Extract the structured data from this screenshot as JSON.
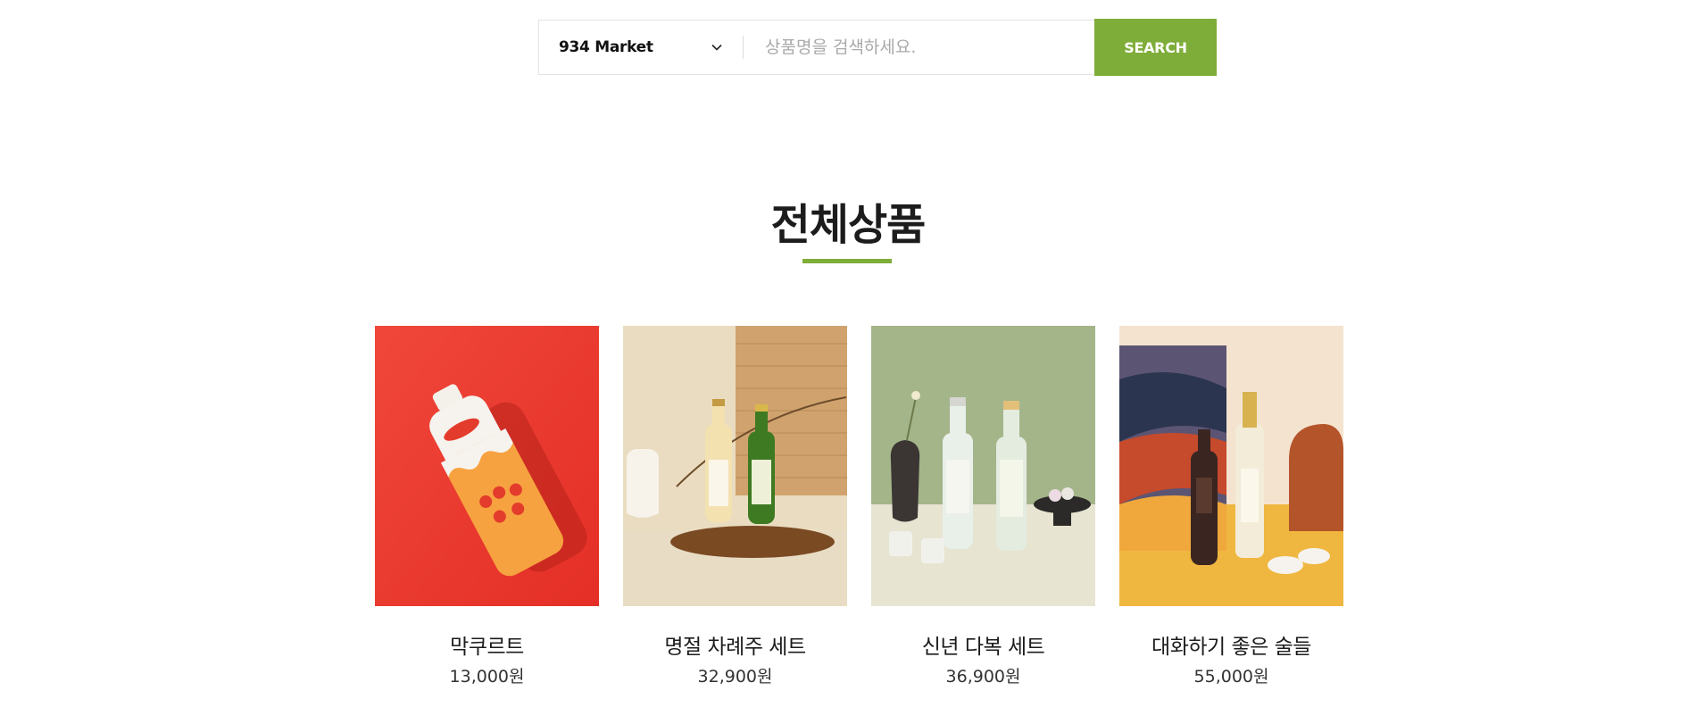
{
  "search": {
    "category_selected": "934 Market",
    "placeholder": "상품명을 검색하세요.",
    "button_label": "SEARCH"
  },
  "section": {
    "title": "전체상품"
  },
  "products": [
    {
      "name": "막쿠르트",
      "price": "13,000원"
    },
    {
      "name": "명절 차례주 세트",
      "price": "32,900원"
    },
    {
      "name": "신년 다복 세트",
      "price": "36,900원"
    },
    {
      "name": "대화하기 좋은 술들",
      "price": "55,000원"
    }
  ],
  "colors": {
    "accent": "#7fad39",
    "text": "#1c1c1c"
  },
  "icons": {
    "dropdown": "chevron-down-icon"
  }
}
